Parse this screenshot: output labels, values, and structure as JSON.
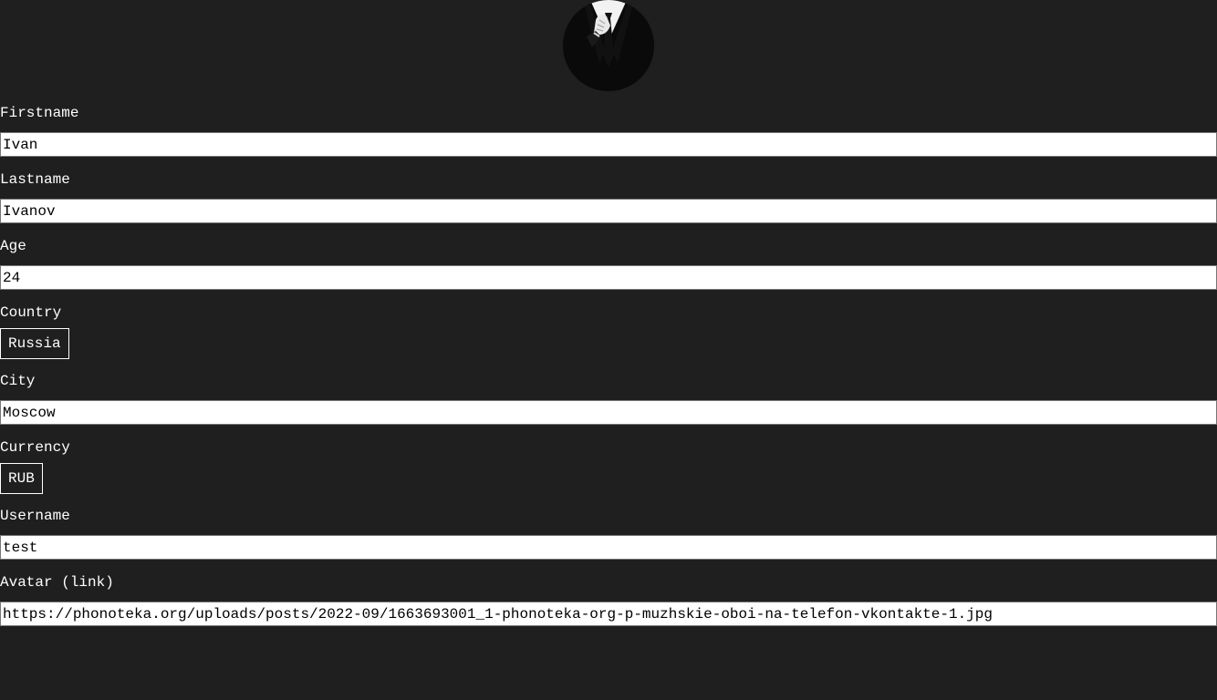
{
  "profile": {
    "avatar_icon": "man-in-suit-tie-avatar",
    "fields": {
      "firstname": {
        "label": "Firstname",
        "value": "Ivan"
      },
      "lastname": {
        "label": "Lastname",
        "value": "Ivanov"
      },
      "age": {
        "label": "Age",
        "value": "24"
      },
      "country": {
        "label": "Country",
        "value": "Russia"
      },
      "city": {
        "label": "City",
        "value": "Moscow"
      },
      "currency": {
        "label": "Currency",
        "value": "RUB"
      },
      "username": {
        "label": "Username",
        "value": "test"
      },
      "avatar_link": {
        "label": "Avatar (link)",
        "value": "https://phonoteka.org/uploads/posts/2022-09/1663693001_1-phonoteka-org-p-muzhskie-oboi-na-telefon-vkontakte-1.jpg"
      }
    }
  },
  "colors": {
    "background": "#1f1f1f",
    "text": "#ffffff",
    "input_background": "#ffffff",
    "input_text": "#000000"
  }
}
